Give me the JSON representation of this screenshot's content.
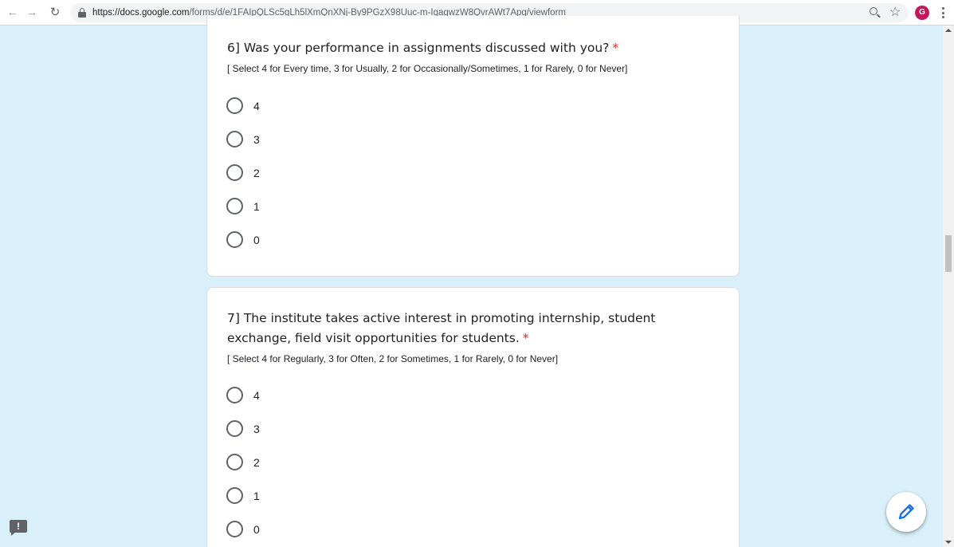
{
  "browser": {
    "url_host": "https://docs.google.com",
    "url_path": "/forms/d/e/1FAIpQLSc5gLh5lXmQnXNj-By9PGzX98Uuc-m-IqaqwzW8QvrAWt7Apg/viewform",
    "avatar_letter": "G",
    "avatar_color": "#c2185b",
    "icons": [
      "back-arrow-icon",
      "forward-arrow-icon",
      "reload-icon",
      "lock-icon",
      "zoom-icon",
      "star-icon",
      "avatar",
      "menu-dots-icon"
    ]
  },
  "theme": {
    "page_background": "#d9eff9",
    "required_color": "#d93025",
    "edit_icon_color": "#1a73e8"
  },
  "questions": [
    {
      "title": "6] Was your performance in assignments discussed with you?",
      "required_mark": "*",
      "help": "[ Select 4 for Every time, 3 for Usually, 2 for Occasionally/Sometimes, 1 for Rarely, 0 for Never]",
      "options": [
        "4",
        "3",
        "2",
        "1",
        "0"
      ]
    },
    {
      "title": "7] The institute takes active interest in promoting internship, student exchange, field visit opportunities for students.",
      "required_mark": "*",
      "help": "[ Select 4 for Regularly, 3 for Often, 2 for Sometimes, 1 for Rarely, 0 for Never]",
      "options": [
        "4",
        "3",
        "2",
        "1",
        "0"
      ]
    }
  ],
  "floating": {
    "edit_button_icon": "pencil-icon",
    "feedback_icon": "report-feedback-icon",
    "feedback_glyph": "!"
  }
}
